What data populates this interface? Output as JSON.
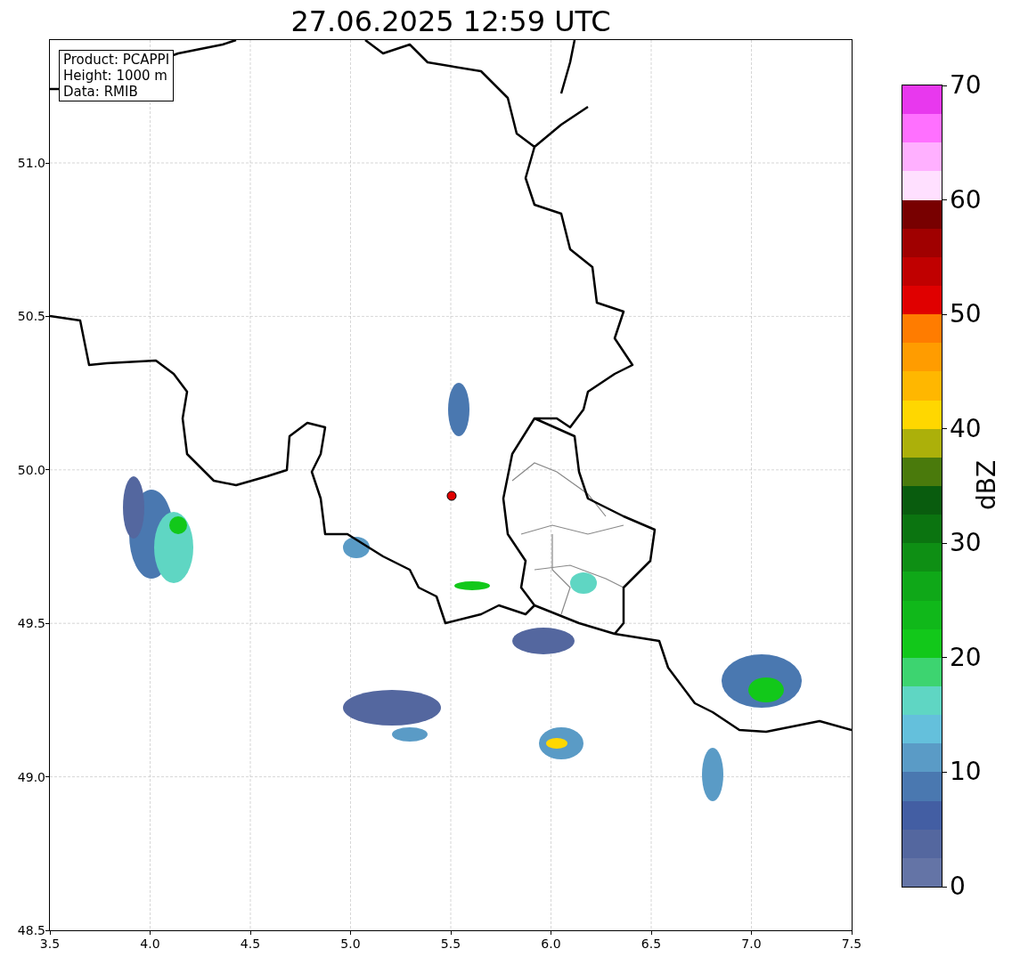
{
  "title": "27.06.2025 12:59 UTC",
  "info_box": [
    "Product: PCAPPI",
    "Height: 1000 m",
    "Data: RMIB"
  ],
  "map": {
    "xticks": [
      "3.5",
      "4.0",
      "4.5",
      "5.0",
      "5.5",
      "6.0",
      "6.5",
      "7.0",
      "7.5"
    ],
    "yticks": [
      "51.0",
      "50.5",
      "50.0",
      "49.5",
      "49.0",
      "48.5"
    ]
  },
  "colorbar": {
    "label": "dBZ",
    "ticks": [
      "70",
      "60",
      "50",
      "40",
      "30",
      "20",
      "10",
      "0"
    ],
    "bands": [
      {
        "color": "#6474a6"
      },
      {
        "color": "#54679f"
      },
      {
        "color": "#435ea3"
      },
      {
        "color": "#4a78b0"
      },
      {
        "color": "#5a9bc6"
      },
      {
        "color": "#64c0dc"
      },
      {
        "color": "#5fd6c3"
      },
      {
        "color": "#3dd470"
      },
      {
        "color": "#12c81a"
      },
      {
        "color": "#10b81a"
      },
      {
        "color": "#0fa818"
      },
      {
        "color": "#0e8f14"
      },
      {
        "color": "#0b7410"
      },
      {
        "color": "#095c0e"
      },
      {
        "color": "#4a7a0c"
      },
      {
        "color": "#acb00a"
      },
      {
        "color": "#ffd700"
      },
      {
        "color": "#ffb700"
      },
      {
        "color": "#ff9c00"
      },
      {
        "color": "#ff7c00"
      },
      {
        "color": "#e00000"
      },
      {
        "color": "#c00000"
      },
      {
        "color": "#a00000"
      },
      {
        "color": "#780000"
      },
      {
        "color": "#ffe0ff"
      },
      {
        "color": "#ffb0ff"
      },
      {
        "color": "#ff70ff"
      },
      {
        "color": "#e838ee"
      }
    ]
  }
}
